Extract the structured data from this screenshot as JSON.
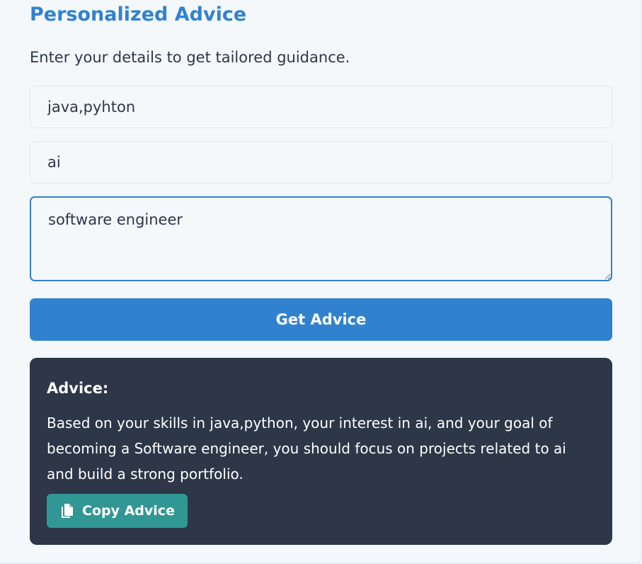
{
  "page": {
    "title": "Personalized Advice",
    "subtitle": "Enter your details to get tailored guidance."
  },
  "form": {
    "skills_value": "java,pyhton",
    "interests_value": "ai",
    "goal_value": "software engineer",
    "submit_label": "Get Advice"
  },
  "advice": {
    "heading": "Advice:",
    "text": "Based on your skills in java,python, your interest in ai, and your goal of becoming a Software engineer, you should focus on projects related to ai and build a strong portfolio.",
    "copy_label": "Copy Advice",
    "copy_icon": "copy-icon"
  },
  "colors": {
    "accent": "#3182ce",
    "advice_background": "#2d3748",
    "copy_button": "#319795"
  }
}
